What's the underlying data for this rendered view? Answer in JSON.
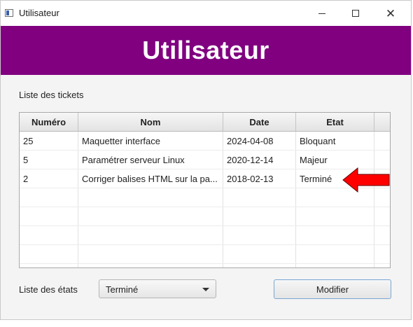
{
  "window": {
    "title": "Utilisateur"
  },
  "banner": {
    "title": "Utilisateur",
    "color": "#800080"
  },
  "tickets": {
    "label": "Liste des tickets",
    "columns": [
      "Numéro",
      "Nom",
      "Date",
      "Etat"
    ],
    "rows": [
      [
        "25",
        "Maquetter interface",
        "2024-04-08",
        "Bloquant"
      ],
      [
        "5",
        "Paramétrer serveur Linux",
        "2020-12-14",
        "Majeur"
      ],
      [
        "2",
        "Corriger balises HTML sur la pa...",
        "2018-02-13",
        "Terminé"
      ]
    ]
  },
  "states": {
    "label": "Liste des états",
    "selected": "Terminé"
  },
  "actions": {
    "modify_label": "Modifier"
  },
  "annotation": {
    "arrow_color": "#ff0000",
    "points_to_row": 3
  }
}
